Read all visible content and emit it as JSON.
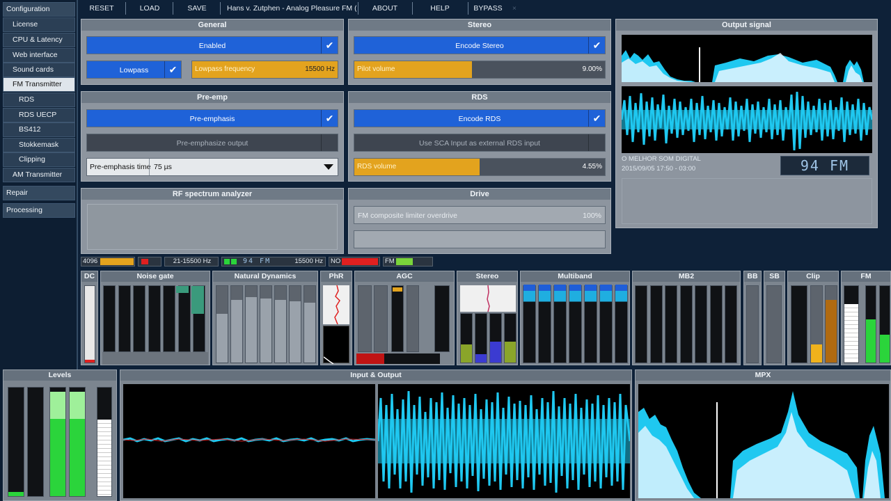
{
  "sidebar": {
    "items": [
      {
        "label": "Configuration",
        "level": "top",
        "active": false
      },
      {
        "label": "License",
        "level": "child",
        "active": false
      },
      {
        "label": "CPU & Latency",
        "level": "child",
        "active": false
      },
      {
        "label": "Web interface",
        "level": "child",
        "active": false
      },
      {
        "label": "Sound cards",
        "level": "child",
        "active": false
      },
      {
        "label": "FM Transmitter",
        "level": "child",
        "active": true
      },
      {
        "label": "RDS",
        "level": "sub",
        "active": false
      },
      {
        "label": "RDS UECP",
        "level": "sub",
        "active": false
      },
      {
        "label": "BS412",
        "level": "sub",
        "active": false
      },
      {
        "label": "Stokkemask",
        "level": "sub",
        "active": false
      },
      {
        "label": "Clipping",
        "level": "sub",
        "active": false
      },
      {
        "label": "AM Transmitter",
        "level": "child",
        "active": false
      },
      {
        "label": "Repair",
        "level": "top",
        "active": false
      },
      {
        "label": "Processing",
        "level": "top",
        "active": false
      }
    ]
  },
  "toolbar": {
    "reset": "RESET",
    "load": "LOAD",
    "save": "SAVE",
    "preset": "Hans v. Zutphen - Analog Pleasure FM (",
    "about": "ABOUT",
    "help": "HELP",
    "bypass": "BYPASS"
  },
  "general": {
    "title": "General",
    "enabled": "Enabled",
    "lowpass": "Lowpass",
    "lowpass_freq_label": "Lowpass frequency",
    "lowpass_freq_value": "15500 Hz"
  },
  "stereo": {
    "title": "Stereo",
    "encode": "Encode Stereo",
    "pilot_label": "Pilot volume",
    "pilot_value": "9.00%",
    "pilot_level": 0.47
  },
  "preemp": {
    "title": "Pre-emp",
    "preemphasis": "Pre-emphasis",
    "preemphasize_output": "Pre-emphasize output",
    "time_label": "Pre-emphasis time",
    "time_value": "75 µs"
  },
  "rds": {
    "title": "RDS",
    "encode": "Encode RDS",
    "sca_input": "Use SCA Input as external RDS input",
    "volume_label": "RDS volume",
    "volume_value": "4.55%",
    "volume_level": 0.5
  },
  "rf": {
    "title": "RF spectrum analyzer"
  },
  "drive": {
    "title": "Drive",
    "limiter_label": "FM composite limiter overdrive",
    "limiter_value": "100%"
  },
  "output": {
    "title": "Output signal",
    "rds_text": "O MELHOR SOM DIGITAL",
    "datetime": "2015/09/05  17:50 - 03:00",
    "station": "94 FM"
  },
  "status": {
    "s1": "4096",
    "s2": "21-15500 Hz",
    "s3_station": "94 FM",
    "s3_freq": "15500 Hz",
    "s4": "NO",
    "s5": "FM"
  },
  "meters": {
    "dc": "DC",
    "noise_gate": "Noise gate",
    "natural_dynamics": "Natural Dynamics",
    "phr": "PhR",
    "agc": "AGC",
    "stereo": "Stereo",
    "multiband": "Multiband",
    "mb2": "MB2",
    "bb": "BB",
    "sb": "SB",
    "clip": "Clip",
    "fm": "FM"
  },
  "scopes": {
    "levels": "Levels",
    "input_output": "Input & Output",
    "mpx": "MPX"
  },
  "colors": {
    "accent_blue": "#1f62d8",
    "slider_orange": "#e3a31e",
    "scope_cyan": "#1fc8f0",
    "meter_green": "#2bd43b"
  }
}
